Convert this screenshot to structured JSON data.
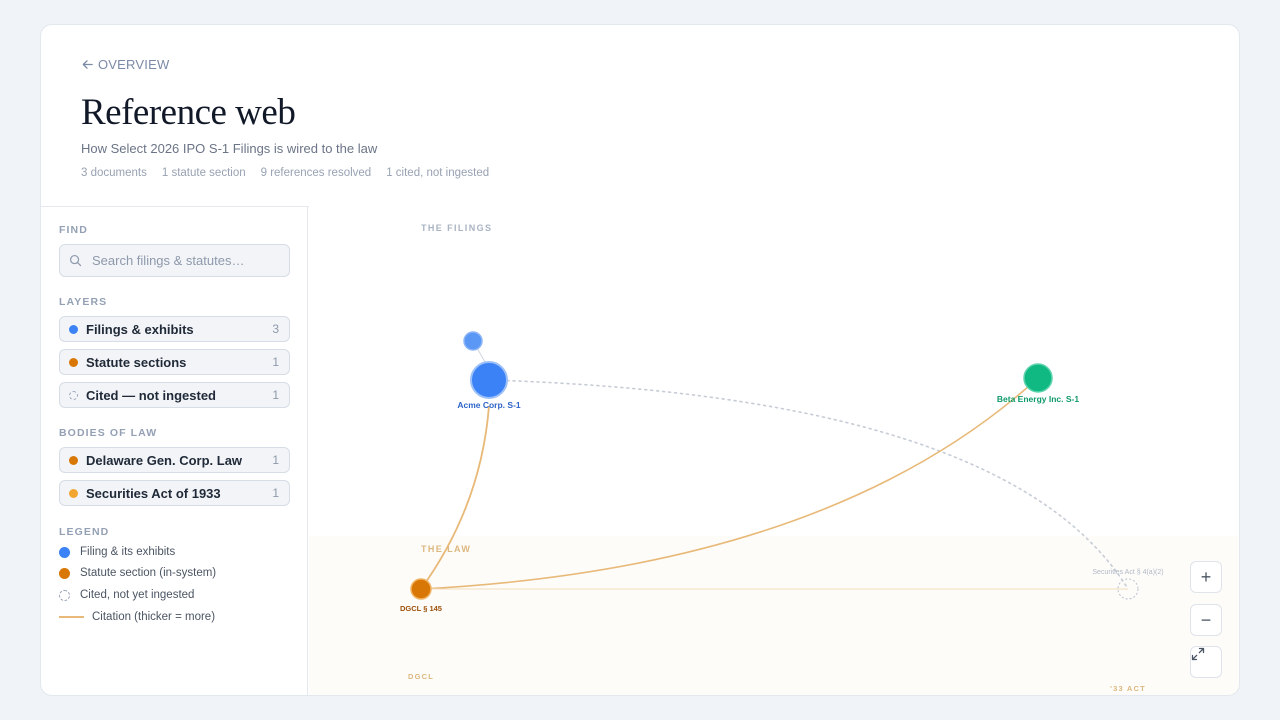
{
  "header": {
    "back_label": "OVERVIEW",
    "title": "Reference web",
    "subtitle": "How Select 2026 IPO S-1 Filings is wired to the law",
    "stats": [
      "3 documents",
      "1 statute section",
      "9 references resolved",
      "1 cited, not ingested"
    ]
  },
  "sidebar": {
    "find_label": "FIND",
    "search_placeholder": "Search filings & statutes…",
    "layers_label": "LAYERS",
    "layers": [
      {
        "label": "Filings & exhibits",
        "count": "3",
        "color": "#3b82f6"
      },
      {
        "label": "Statute sections",
        "count": "1",
        "color": "#d97706"
      },
      {
        "label": "Cited — not ingested",
        "count": "1",
        "color": "dashed"
      }
    ],
    "bodies_label": "BODIES OF LAW",
    "bodies": [
      {
        "label": "Delaware Gen. Corp. Law",
        "count": "1",
        "color": "#d97706"
      },
      {
        "label": "Securities Act of 1933",
        "count": "1",
        "color": "#f2a531"
      }
    ],
    "legend_label": "LEGEND",
    "legend": [
      {
        "label": "Filing & its exhibits",
        "icon": "blue-dot"
      },
      {
        "label": "Statute section (in-system)",
        "icon": "orange-dot"
      },
      {
        "label": "Cited, not yet ingested",
        "icon": "dashed-circle"
      },
      {
        "label": "Citation (thicker = more)",
        "icon": "line"
      }
    ]
  },
  "graph": {
    "band_filings": "THE FILINGS",
    "band_law": "THE LAW",
    "band_dgcl": "DGCL",
    "band_33act": "'33 ACT",
    "nodes": {
      "acme": "Acme Corp. S-1",
      "beta": "Beta Energy Inc. S-1",
      "dgcl": "DGCL § 145",
      "secact": "Securities Act § 4(a)(2)"
    }
  },
  "colors": {
    "filing": "#3b82f6",
    "beta": "#10b981",
    "statute": "#d97706",
    "citation": "#e8b978",
    "cited_not_ingested": "#b9c2cf"
  },
  "controls": {
    "zoom_in": "+",
    "zoom_out": "−",
    "fit": "fit-screen-icon"
  }
}
